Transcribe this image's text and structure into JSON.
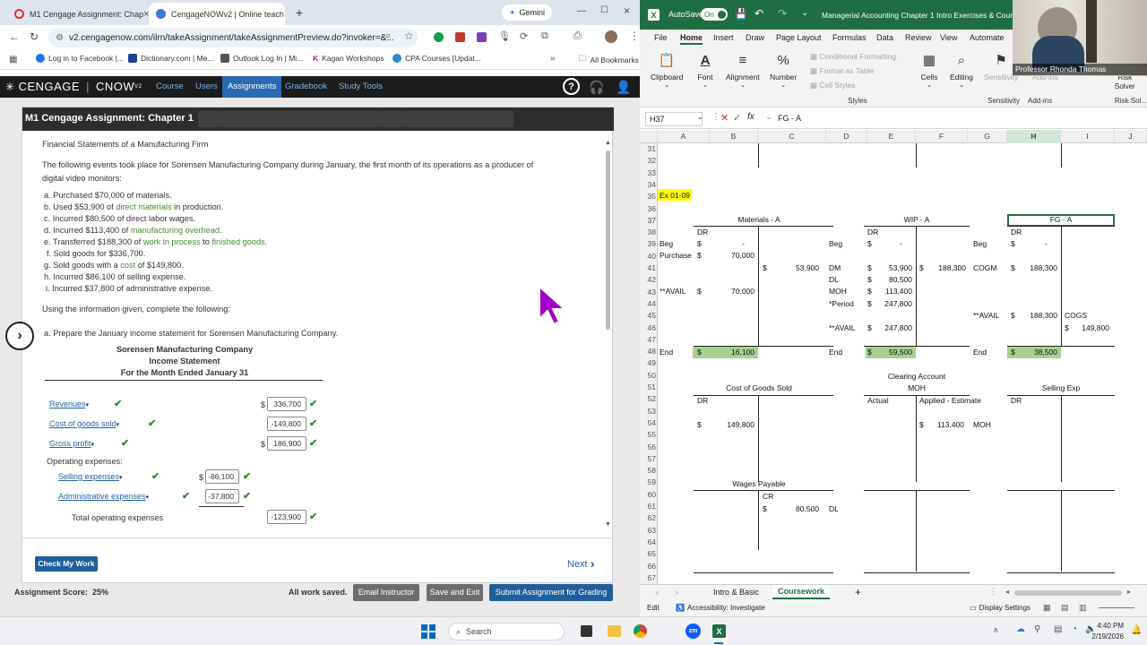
{
  "browser": {
    "tabs": [
      {
        "label": "M1 Cengage Assignment: Chap"
      },
      {
        "label": "CengageNOWv2 | Online teach"
      }
    ],
    "gemini_label": "Gemini",
    "url": "v2.cengagenow.com/ilrn/takeAssignment/takeAssignmentPreview.do?invoker=&...",
    "bookmarks": [
      "Log in to Facebook |...",
      "Dictionary.com | Me...",
      "Outlook Log In | Mi...",
      "Kagan Workshops",
      "CPA Courses [Updat..."
    ],
    "all_bookmarks": "All Bookmarks"
  },
  "cengage": {
    "brand": "CENGAGE",
    "product": "CNOW",
    "product_sup": "V2",
    "nav": [
      "Course",
      "Users",
      "Assignments",
      "Gradebook",
      "Study Tools"
    ],
    "assignment_title": "M1 Cengage Assignment: Chapter 1",
    "problem_title": "Financial Statements of a Manufacturing Firm",
    "intro_1": "The following events took place for Sorensen Manufacturing Company during January, the first month of its operations as a producer of",
    "intro_2": "digital video monitors:",
    "events": {
      "a": "a. Purchased $70,000 of materials.",
      "b_pre": "b. Used $53,900 of ",
      "b_link": "direct materials",
      "b_post": " in production.",
      "c": "c. Incurred $80,500 of direct labor wages.",
      "d_pre": "d. Incurred $113,400 of ",
      "d_link": "manufacturing overhead",
      "d_post": ".",
      "e_pre": "e. Transferred $188,300 of ",
      "e_link1": "work in process",
      "e_mid": " to ",
      "e_link2": "finished goods",
      "e_post": ".",
      "f": "f. Sold goods for $336,700.",
      "g_pre": "g. Sold goods with a ",
      "g_link": "cost",
      "g_post": " of $149,800.",
      "h": "h. Incurred $86,100 of selling expense.",
      "i": "i. Incurred $37,800 of administrative expense."
    },
    "instructions": "Using the information given, complete the following:",
    "part_a": "a.  Prepare the January income statement for Sorensen Manufacturing Company.",
    "statement": {
      "company": "Sorensen Manufacturing Company",
      "name": "Income Statement",
      "period": "For the Month Ended January 31",
      "revenues_label": "Revenues",
      "revenues_value": "336,700",
      "cogs_label": "Cost of goods sold",
      "cogs_value": "-149,800",
      "gross_label": "Gross profit",
      "gross_value": "186,900",
      "opex_label": "Operating expenses:",
      "selling_label": "Selling expenses",
      "selling_value": "-86,100",
      "admin_label": "Administrative expenses",
      "admin_value": "-37,800",
      "total_opex_label": "Total operating expenses",
      "total_opex_value": "-123,900",
      "currency": "$"
    },
    "check_button": "Check My Work",
    "next_button": "Next",
    "score_label": "Assignment Score:",
    "score_value": "25%",
    "saved": "All work saved.",
    "email_button": "Email Instructor",
    "save_exit_button": "Save and Exit",
    "submit_button": "Submit Assignment for Grading"
  },
  "excel": {
    "autosave": "AutoSave",
    "autosave_state": "On",
    "title": "Managerial Accounting Chapter 1 Intro Exercises & Coursewo",
    "presenter": "Professor Rhonda Thomas",
    "menu": [
      "File",
      "Home",
      "Insert",
      "Draw",
      "Page Layout",
      "Formulas",
      "Data",
      "Review",
      "View",
      "Automate"
    ],
    "ribbon": {
      "clipboard": "Clipboard",
      "font": "Font",
      "alignment": "Alignment",
      "number": "Number",
      "cond_format": "Conditional Formatting",
      "format_table": "Format as Table",
      "cell_styles": "Cell Styles",
      "styles": "Styles",
      "cells": "Cells",
      "editing": "Editing",
      "sensitivity": "Sensitivity",
      "addins": "Add-ins",
      "addins_group": "Add-ins",
      "sensitivity_group": "Sensitivity",
      "risk_solver_1": "Risk",
      "risk_solver_2": "Solver",
      "risk_group": "Risk Sol..."
    },
    "name_box": "H37",
    "formula": "FG - A",
    "columns": [
      "A",
      "B",
      "C",
      "D",
      "E",
      "F",
      "G",
      "H",
      "I",
      "J"
    ],
    "rows": [
      "31",
      "32",
      "33",
      "34",
      "35",
      "36",
      "37",
      "38",
      "39",
      "40",
      "41",
      "42",
      "43",
      "44",
      "45",
      "46",
      "47",
      "48",
      "49",
      "50",
      "51",
      "52",
      "53",
      "54",
      "55",
      "56",
      "57",
      "58",
      "59",
      "60",
      "61",
      "62",
      "63",
      "64",
      "65",
      "66",
      "67"
    ],
    "cells": {
      "ex": "Ex 01-09",
      "mat_title": "Materials - A",
      "wip_title": "WIP - A",
      "fg_title": "FG - A",
      "dr": "DR",
      "cr": "CR",
      "beg": "Beg",
      "purchase": "Purchase",
      "avail": "**AVAIL",
      "end": "End",
      "dollar": "$",
      "dash": "-",
      "m_purchase": "70,000",
      "m_used": "53,900",
      "m_avail": "70,000",
      "m_end": "16,100",
      "dm": "DM",
      "dl": "DL",
      "moh": "MOH",
      "period": "*Period",
      "w_dm": "53,900",
      "w_dl": "80,500",
      "w_moh": "113,400",
      "w_period": "247,800",
      "w_avail": "247,800",
      "w_end": "59,500",
      "w_out": "188,300",
      "cogm": "COGM",
      "f_cogm": "188,300",
      "f_avail": "188,300",
      "cogs": "COGS",
      "f_cogs": "149,800",
      "f_end": "38,500",
      "clearing": "Clearing Account",
      "moh_title": "MOH",
      "actual": "Actual",
      "applied": "Applied - Estimate",
      "moh_applied": "113,400",
      "moh_ref": "MOH",
      "cogs_title": "Cost of Goods Sold",
      "cogs_val": "149,800",
      "selling_title": "Selling Exp",
      "wages_title": "Wages Payable",
      "wages_val": "80,500",
      "wages_ref": "DL"
    },
    "sheets": [
      "Intro & Basic",
      "Coursework"
    ],
    "status_mode": "Edit",
    "accessibility": "Accessibility: Investigate",
    "display_settings": "Display Settings"
  },
  "taskbar": {
    "search": "Search",
    "time": "4:40 PM",
    "date": "2/19/2026"
  }
}
